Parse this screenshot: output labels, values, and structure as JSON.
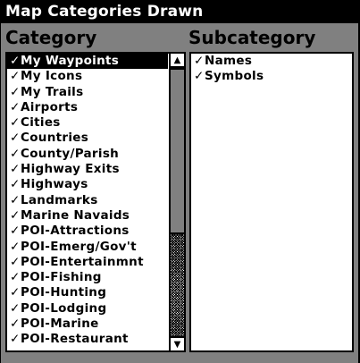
{
  "window": {
    "title": "Map Categories Drawn"
  },
  "headers": {
    "category": "Category",
    "subcategory": "Subcategory"
  },
  "check_glyph": "✓",
  "categories": [
    {
      "label": "My Waypoints",
      "selected": true
    },
    {
      "label": "My Icons"
    },
    {
      "label": "My Trails"
    },
    {
      "label": "Airports"
    },
    {
      "label": "Cities"
    },
    {
      "label": "Countries"
    },
    {
      "label": "County/Parish"
    },
    {
      "label": "Highway Exits"
    },
    {
      "label": "Highways"
    },
    {
      "label": "Landmarks"
    },
    {
      "label": "Marine Navaids"
    },
    {
      "label": "POI-Attractions"
    },
    {
      "label": "POI-Emerg/Gov't"
    },
    {
      "label": "POI-Entertainmnt"
    },
    {
      "label": "POI-Fishing"
    },
    {
      "label": "POI-Hunting"
    },
    {
      "label": "POI-Lodging"
    },
    {
      "label": "POI-Marine"
    },
    {
      "label": "POI-Restaurant"
    }
  ],
  "subcategories": [
    {
      "label": "Names"
    },
    {
      "label": "Symbols"
    }
  ],
  "scroll": {
    "position": 0.0,
    "visible_fraction": 0.62
  },
  "icons": {
    "scroll_up": "up-arrow-icon",
    "scroll_down": "down-arrow-icon",
    "check": "check-icon"
  }
}
